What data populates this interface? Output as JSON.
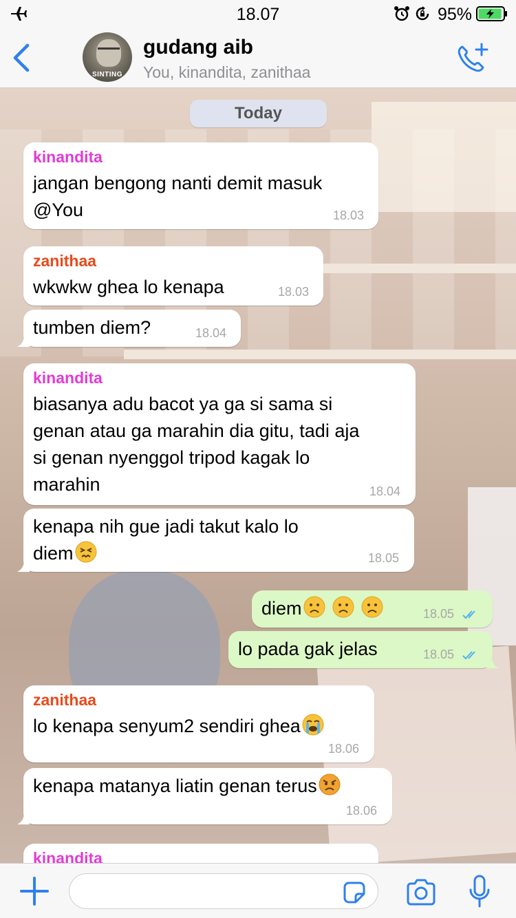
{
  "status_bar": {
    "time": "18.07",
    "battery_percent": "95%",
    "battery_level": 0.95
  },
  "header": {
    "title": "gudang aib",
    "subtitle": "You, kinandita, zanithaa",
    "avatar_text": "SINTING"
  },
  "chat": {
    "date_label": "Today",
    "messages": [
      {
        "sender": "kinandita",
        "text": "jangan bengong nanti demit masuk\n@You",
        "time": "18.03",
        "direction": "in"
      },
      {
        "sender": "zanithaa",
        "text": "wkwkw ghea lo kenapa",
        "time": "18.03",
        "direction": "in"
      },
      {
        "sender": "",
        "text": "tumben diem?",
        "time": "18.04",
        "direction": "in"
      },
      {
        "sender": "kinandita",
        "text": "biasanya adu bacot ya ga si sama si\ngenan atau ga marahin dia gitu, tadi aja\nsi genan nyenggol tripod kagak lo\nmarahin",
        "time": "18.04",
        "direction": "in"
      },
      {
        "sender": "",
        "text": "kenapa nih gue jadi takut kalo lo\ndiem",
        "emoji": "persevering-face",
        "time": "18.05",
        "direction": "in"
      },
      {
        "sender": "",
        "text": "diem",
        "emoji": "frowning-face x3",
        "time": "18.05",
        "direction": "out",
        "status": "read"
      },
      {
        "sender": "",
        "text": "lo pada gak jelas",
        "time": "18.05",
        "direction": "out",
        "status": "read"
      },
      {
        "sender": "zanithaa",
        "text": "lo kenapa senyum2 sendiri ghea",
        "emoji": "crying-face",
        "time": "18.06",
        "direction": "in"
      },
      {
        "sender": "",
        "text": "kenapa matanya liatin genan terus",
        "emoji": "angry-face",
        "time": "18.06",
        "direction": "in"
      },
      {
        "sender": "kinandita",
        "text": "",
        "time": "",
        "direction": "in"
      }
    ]
  },
  "colors": {
    "accent": "#2f80ed",
    "sender_kinandita": "#e13bd6",
    "sender_zanithaa": "#e84a1b",
    "outgoing_bubble": "#dcf8c6",
    "read_ticks": "#4fb3f0"
  },
  "input_bar": {
    "placeholder": ""
  },
  "icons": [
    "airplane-icon",
    "alarm-icon",
    "rotation-lock-icon",
    "battery-icon",
    "back-icon",
    "add-call-icon",
    "plus-icon",
    "sticker-icon",
    "camera-icon",
    "microphone-icon"
  ]
}
